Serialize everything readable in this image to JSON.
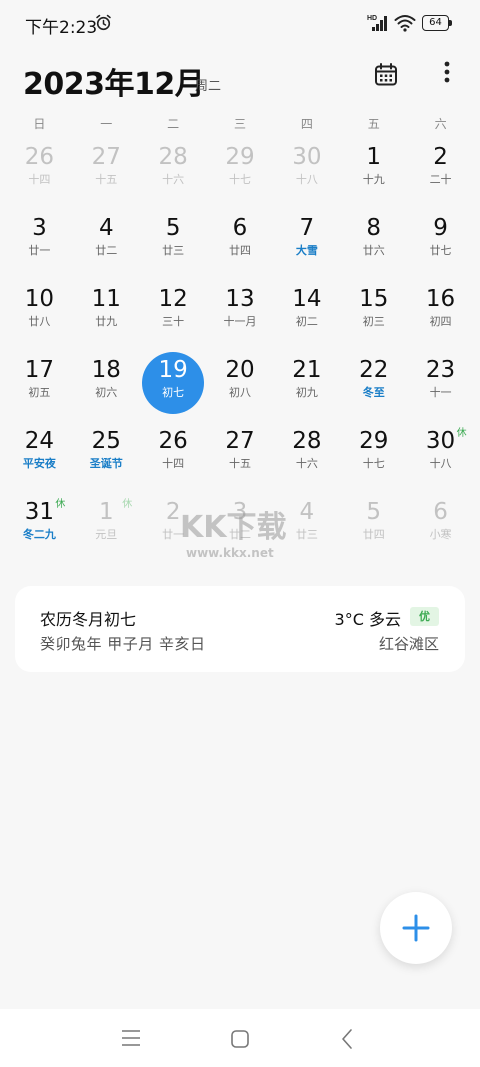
{
  "status_bar": {
    "time": "下午2:23",
    "network_label": "HD",
    "battery": "64"
  },
  "header": {
    "month_title": "2023年12月",
    "weekday": "周二"
  },
  "weekday_labels": [
    "日",
    "一",
    "二",
    "三",
    "四",
    "五",
    "六"
  ],
  "calendar": {
    "days": [
      {
        "day": "26",
        "sub": "十四",
        "other": true
      },
      {
        "day": "27",
        "sub": "十五",
        "other": true
      },
      {
        "day": "28",
        "sub": "十六",
        "other": true
      },
      {
        "day": "29",
        "sub": "十七",
        "other": true
      },
      {
        "day": "30",
        "sub": "十八",
        "other": true
      },
      {
        "day": "1",
        "sub": "十九"
      },
      {
        "day": "2",
        "sub": "二十"
      },
      {
        "day": "3",
        "sub": "廿一"
      },
      {
        "day": "4",
        "sub": "廿二"
      },
      {
        "day": "5",
        "sub": "廿三"
      },
      {
        "day": "6",
        "sub": "廿四"
      },
      {
        "day": "7",
        "sub": "大雪",
        "festival": true
      },
      {
        "day": "8",
        "sub": "廿六"
      },
      {
        "day": "9",
        "sub": "廿七"
      },
      {
        "day": "10",
        "sub": "廿八"
      },
      {
        "day": "11",
        "sub": "廿九"
      },
      {
        "day": "12",
        "sub": "三十"
      },
      {
        "day": "13",
        "sub": "十一月"
      },
      {
        "day": "14",
        "sub": "初二"
      },
      {
        "day": "15",
        "sub": "初三"
      },
      {
        "day": "16",
        "sub": "初四"
      },
      {
        "day": "17",
        "sub": "初五"
      },
      {
        "day": "18",
        "sub": "初六"
      },
      {
        "day": "19",
        "sub": "初七",
        "today": true
      },
      {
        "day": "20",
        "sub": "初八"
      },
      {
        "day": "21",
        "sub": "初九"
      },
      {
        "day": "22",
        "sub": "冬至",
        "festival": true
      },
      {
        "day": "23",
        "sub": "十一"
      },
      {
        "day": "24",
        "sub": "平安夜",
        "festival": true
      },
      {
        "day": "25",
        "sub": "圣诞节",
        "festival": true
      },
      {
        "day": "26",
        "sub": "十四"
      },
      {
        "day": "27",
        "sub": "十五"
      },
      {
        "day": "28",
        "sub": "十六"
      },
      {
        "day": "29",
        "sub": "十七"
      },
      {
        "day": "30",
        "sub": "十八",
        "rest": "休"
      },
      {
        "day": "31",
        "sub": "冬二九",
        "festival": true,
        "rest": "休"
      },
      {
        "day": "1",
        "sub": "元旦",
        "other": true,
        "rest": "休"
      },
      {
        "day": "2",
        "sub": "廿一",
        "other": true
      },
      {
        "day": "3",
        "sub": "廿二",
        "other": true
      },
      {
        "day": "4",
        "sub": "廿三",
        "other": true
      },
      {
        "day": "5",
        "sub": "廿四",
        "other": true
      },
      {
        "day": "6",
        "sub": "小寒",
        "other": true
      }
    ]
  },
  "watermark": {
    "logo": "KK下载",
    "url": "www.kkx.net"
  },
  "info_card": {
    "lunar_date": "农历冬月初七",
    "ganzhi": "癸卯兔年 甲子月 辛亥日",
    "weather": "3°C 多云",
    "aqi": "优",
    "location": "红谷滩区"
  },
  "colors": {
    "accent": "#2d8fe8",
    "festival": "#1a7ec7",
    "rest": "#3caa52"
  }
}
